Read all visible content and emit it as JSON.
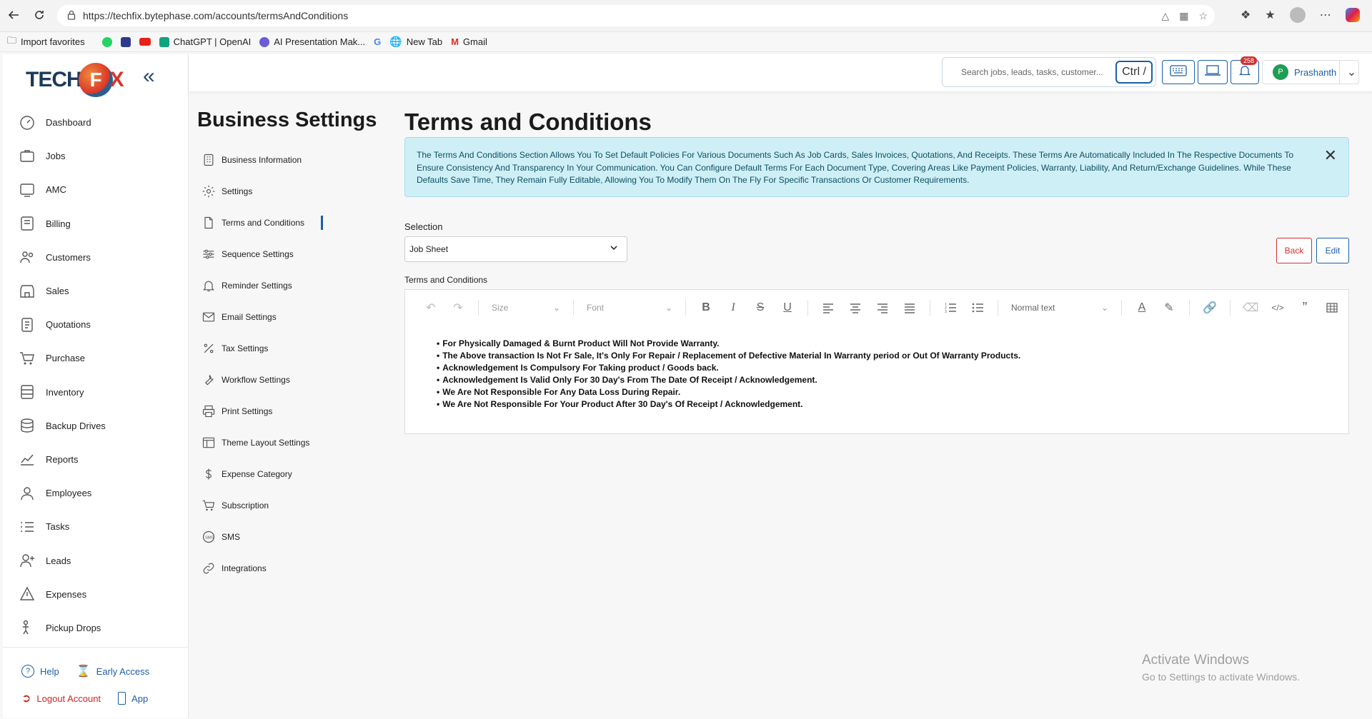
{
  "browser": {
    "url": "https://techfix.bytephase.com/accounts/termsAndConditions",
    "bookmarks": [
      "Import favorites",
      "ChatGPT | OpenAI",
      "AI Presentation Mak...",
      "New Tab",
      "Gmail"
    ]
  },
  "sidebar": {
    "logo": {
      "left": "TECH",
      "mid": "F",
      "right": "X"
    },
    "items": [
      {
        "label": "Dashboard",
        "icon": "dashboard-icon"
      },
      {
        "label": "Jobs",
        "icon": "jobs-icon"
      },
      {
        "label": "AMC",
        "icon": "amc-icon"
      },
      {
        "label": "Billing",
        "icon": "billing-icon"
      },
      {
        "label": "Customers",
        "icon": "customers-icon"
      },
      {
        "label": "Sales",
        "icon": "sales-icon"
      },
      {
        "label": "Quotations",
        "icon": "quotations-icon"
      },
      {
        "label": "Purchase",
        "icon": "cart-icon"
      },
      {
        "label": "Inventory",
        "icon": "inventory-icon"
      },
      {
        "label": "Backup Drives",
        "icon": "database-icon"
      },
      {
        "label": "Reports",
        "icon": "reports-icon"
      },
      {
        "label": "Employees",
        "icon": "employees-icon"
      },
      {
        "label": "Tasks",
        "icon": "tasks-icon"
      },
      {
        "label": "Leads",
        "icon": "leads-icon"
      },
      {
        "label": "Expenses",
        "icon": "expenses-icon"
      },
      {
        "label": "Pickup Drops",
        "icon": "pickup-icon"
      }
    ],
    "footer": {
      "help": "Help",
      "early_access": "Early Access",
      "logout": "Logout Account",
      "app": "App"
    }
  },
  "topbar": {
    "search_placeholder": "Search jobs, leads, tasks, customer...",
    "shortcut": "Ctrl /",
    "notifications": "258",
    "user_initial": "P",
    "user_name": "Prashanth"
  },
  "settings": {
    "title": "Business Settings",
    "items": [
      {
        "label": "Business Information",
        "icon": "business-info-icon"
      },
      {
        "label": "Settings",
        "icon": "gear-icon"
      },
      {
        "label": "Terms and Conditions",
        "icon": "document-icon",
        "active": true
      },
      {
        "label": "Sequence Settings",
        "icon": "sliders-icon"
      },
      {
        "label": "Reminder Settings",
        "icon": "bell-icon"
      },
      {
        "label": "Email Settings",
        "icon": "mail-icon"
      },
      {
        "label": "Tax Settings",
        "icon": "percent-icon"
      },
      {
        "label": "Workflow Settings",
        "icon": "wrench-icon"
      },
      {
        "label": "Print Settings",
        "icon": "printer-icon"
      },
      {
        "label": "Theme Layout Settings",
        "icon": "layout-icon"
      },
      {
        "label": "Expense Category",
        "icon": "dollar-icon"
      },
      {
        "label": "Subscription",
        "icon": "cart-icon"
      },
      {
        "label": "SMS",
        "icon": "sms-icon"
      },
      {
        "label": "Integrations",
        "icon": "link-icon"
      }
    ]
  },
  "main": {
    "title": "Terms and Conditions",
    "info": "The Terms And Conditions Section Allows You To Set Default Policies For Various Documents Such As Job Cards, Sales Invoices, Quotations, And Receipts. These Terms Are Automatically Included In The Respective Documents To Ensure Consistency And Transparency In Your Communication. You Can Configure Default Terms For Each Document Type, Covering Areas Like Payment Policies, Warranty, Liability, And Return/Exchange Guidelines. While These Defaults Save Time, They Remain Fully Editable, Allowing You To Modify Them On The Fly For Specific Transactions Or Customer Requirements.",
    "selection_label": "Selection",
    "selection_value": "Job Sheet",
    "back_label": "Back",
    "edit_label": "Edit",
    "terms_label": "Terms and Conditions",
    "toolbar": {
      "size": "Size",
      "font": "Font",
      "block": "Normal text"
    },
    "terms": [
      "For Physically Damaged & Burnt Product Will Not Provide Warranty.",
      "The Above transaction Is Not Fr Sale, It's Only For Repair / Replacement of Defective Material In Warranty period or Out Of Warranty Products.",
      "Acknowledgement Is Compulsory For Taking product / Goods back.",
      "Acknowledgement Is Valid Only For 30 Day's From The Date Of Receipt / Acknowledgement.",
      "We Are Not Responsible For Any Data Loss During Repair.",
      "We Are Not Responsible For Your Product After 30 Day's Of Receipt / Acknowledgement."
    ]
  },
  "watermark": {
    "line1": "Activate Windows",
    "line2": "Go to Settings to activate Windows."
  }
}
